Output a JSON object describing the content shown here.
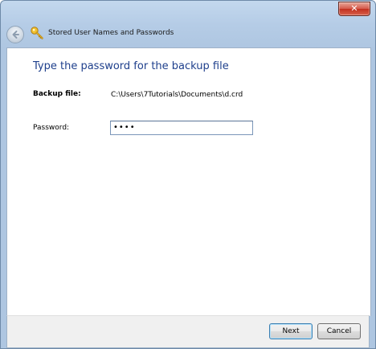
{
  "window": {
    "title": "Stored User Names and Passwords",
    "close_label": "✕"
  },
  "content": {
    "heading": "Type the password for the backup file",
    "backup_label": "Backup file:",
    "backup_value": "C:\\Users\\7Tutorials\\Documents\\d.crd",
    "password_label": "Password:",
    "password_value": "••••"
  },
  "footer": {
    "next_label": "Next",
    "cancel_label": "Cancel"
  },
  "colors": {
    "heading": "#1e3f8c",
    "close_button": "#c2301f"
  },
  "icons": {
    "back": "back-arrow-icon",
    "title": "key-icon",
    "close": "close-icon"
  }
}
